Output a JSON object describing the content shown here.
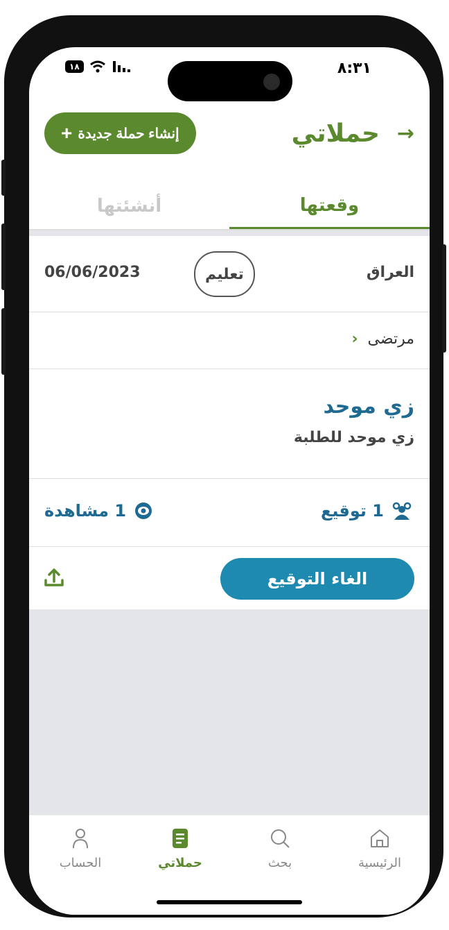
{
  "status_bar": {
    "time": "٨:٣١",
    "battery": "١٨"
  },
  "header": {
    "title": "حملاتي",
    "new_campaign_button": "إنشاء حملة جديدة"
  },
  "tabs": [
    {
      "label": "وقعتها",
      "active": true
    },
    {
      "label": "أنشئتها",
      "active": false
    }
  ],
  "campaign": {
    "country": "العراق",
    "category": "تعليم",
    "date": "06/06/2023",
    "author": "مرتضى",
    "title": "زي موحد",
    "description": "زي موحد للطلبة",
    "signatures": "1 توقيع",
    "views": "1 مشاهدة",
    "cancel_button": "الغاء التوقيع"
  },
  "bottom_nav": [
    {
      "label": "الرئيسية",
      "icon": "home-icon"
    },
    {
      "label": "بحث",
      "icon": "search-icon"
    },
    {
      "label": "حملاتي",
      "icon": "campaigns-icon",
      "active": true
    },
    {
      "label": "الحساب",
      "icon": "account-icon"
    }
  ],
  "colors": {
    "primary_green": "#5b8a2e",
    "primary_blue": "#1e6a92",
    "button_blue": "#1e8ab0"
  }
}
